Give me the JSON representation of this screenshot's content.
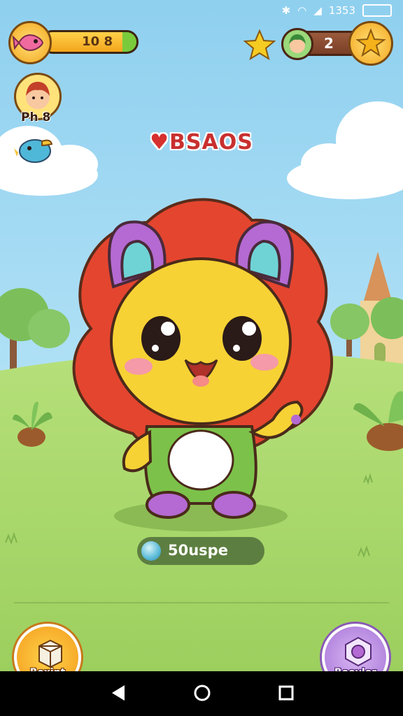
{
  "status_bar": {
    "time": "1353"
  },
  "hud": {
    "coins": "10 8",
    "player_badge_label": "Ph 8",
    "level": "2"
  },
  "pet": {
    "name": "BSAOS"
  },
  "xp": {
    "label": "50uspe"
  },
  "buttons": {
    "left_label": "Boxint",
    "right_label": "Boovler"
  },
  "icons": {
    "coin_icon": "pink-fish-icon",
    "star_icon": "star-icon",
    "heart_icon": "heart-icon",
    "bird_icon": "bird-icon",
    "xp_icon": "bubble-icon",
    "box_icon": "box-icon",
    "shop_icon": "cube-icon",
    "back_icon": "back-triangle-icon",
    "home_icon": "home-circle-icon",
    "recent_icon": "recent-square-icon"
  },
  "colors": {
    "sky": "#9fd7f1",
    "grass": "#a7d86a",
    "pet_body": "#f6d235",
    "pet_mane": "#e9503a",
    "accent_gold": "#f4b51e",
    "accent_purple": "#b98ee0"
  }
}
